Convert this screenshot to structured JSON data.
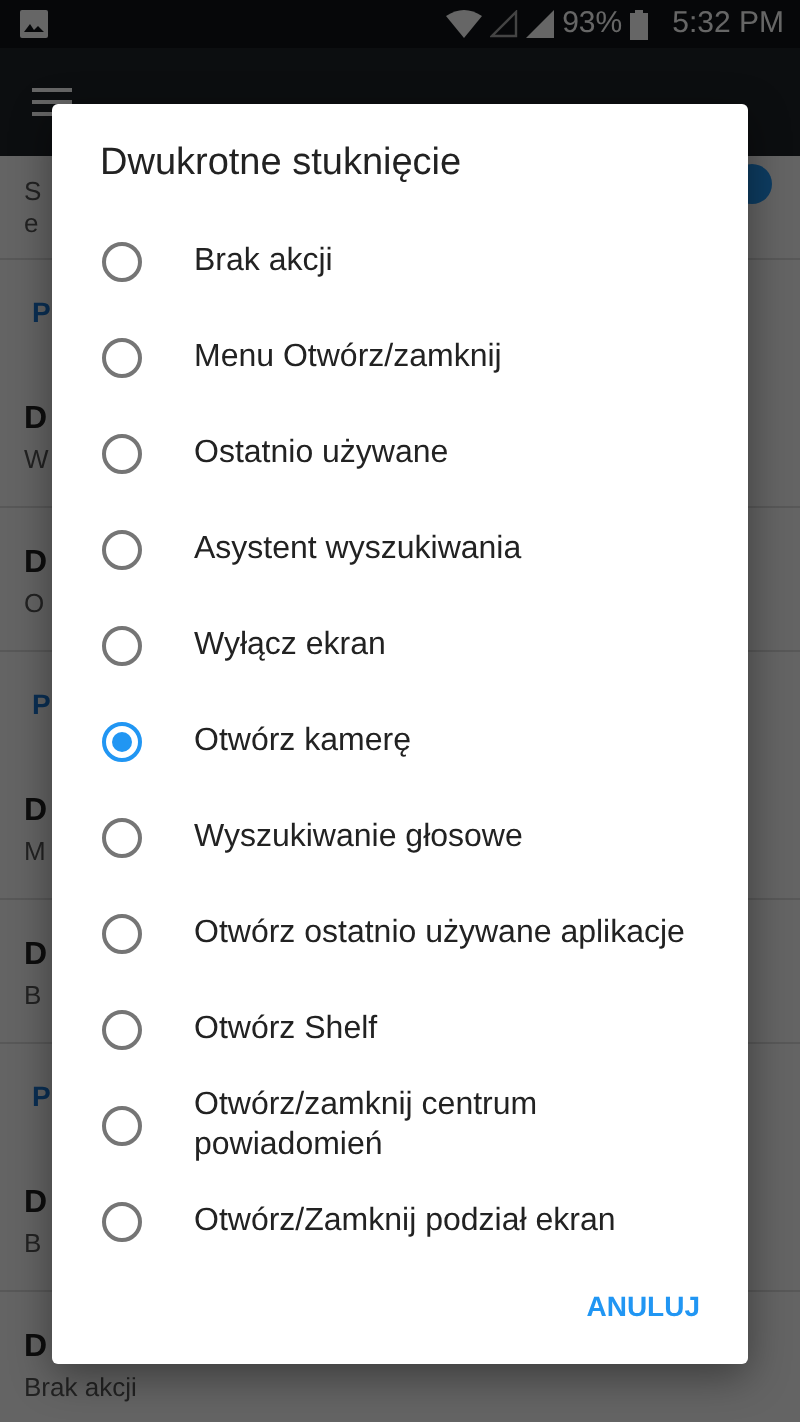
{
  "status_bar": {
    "battery": "93%",
    "time": "5:32 PM"
  },
  "background_list": [
    {
      "kind": "row",
      "subtitle_lines": [
        "S",
        "e"
      ],
      "switch_on": true
    },
    {
      "kind": "section",
      "title": "P"
    },
    {
      "kind": "row",
      "title": "D",
      "subtitle_lines": [
        "W"
      ]
    },
    {
      "kind": "row",
      "title": "D",
      "subtitle_lines": [
        "O"
      ]
    },
    {
      "kind": "section",
      "title": "P"
    },
    {
      "kind": "row",
      "title": "D",
      "subtitle_lines": [
        "M"
      ]
    },
    {
      "kind": "row",
      "title": "D",
      "subtitle_lines": [
        "B"
      ]
    },
    {
      "kind": "section",
      "title": "P"
    },
    {
      "kind": "row",
      "title": "D",
      "subtitle_lines": [
        "B"
      ]
    },
    {
      "kind": "row",
      "title": "D",
      "subtitle_lines": [
        "Brak akcji"
      ]
    }
  ],
  "dialog": {
    "title": "Dwukrotne stuknięcie",
    "options": [
      {
        "label": "Brak akcji",
        "selected": false
      },
      {
        "label": "Menu Otwórz/zamknij",
        "selected": false
      },
      {
        "label": "Ostatnio używane",
        "selected": false
      },
      {
        "label": "Asystent wyszukiwania",
        "selected": false
      },
      {
        "label": "Wyłącz ekran",
        "selected": false
      },
      {
        "label": "Otwórz kamerę",
        "selected": true
      },
      {
        "label": "Wyszukiwanie głosowe",
        "selected": false
      },
      {
        "label": "Otwórz ostatnio używane aplikacje",
        "selected": false
      },
      {
        "label": "Otwórz Shelf",
        "selected": false
      },
      {
        "label": "Otwórz/zamknij centrum powiadomień",
        "selected": false
      },
      {
        "label": "Otwórz/Zamknij podział ekran",
        "selected": false
      }
    ],
    "buttons": [
      "ANULUJ"
    ]
  }
}
